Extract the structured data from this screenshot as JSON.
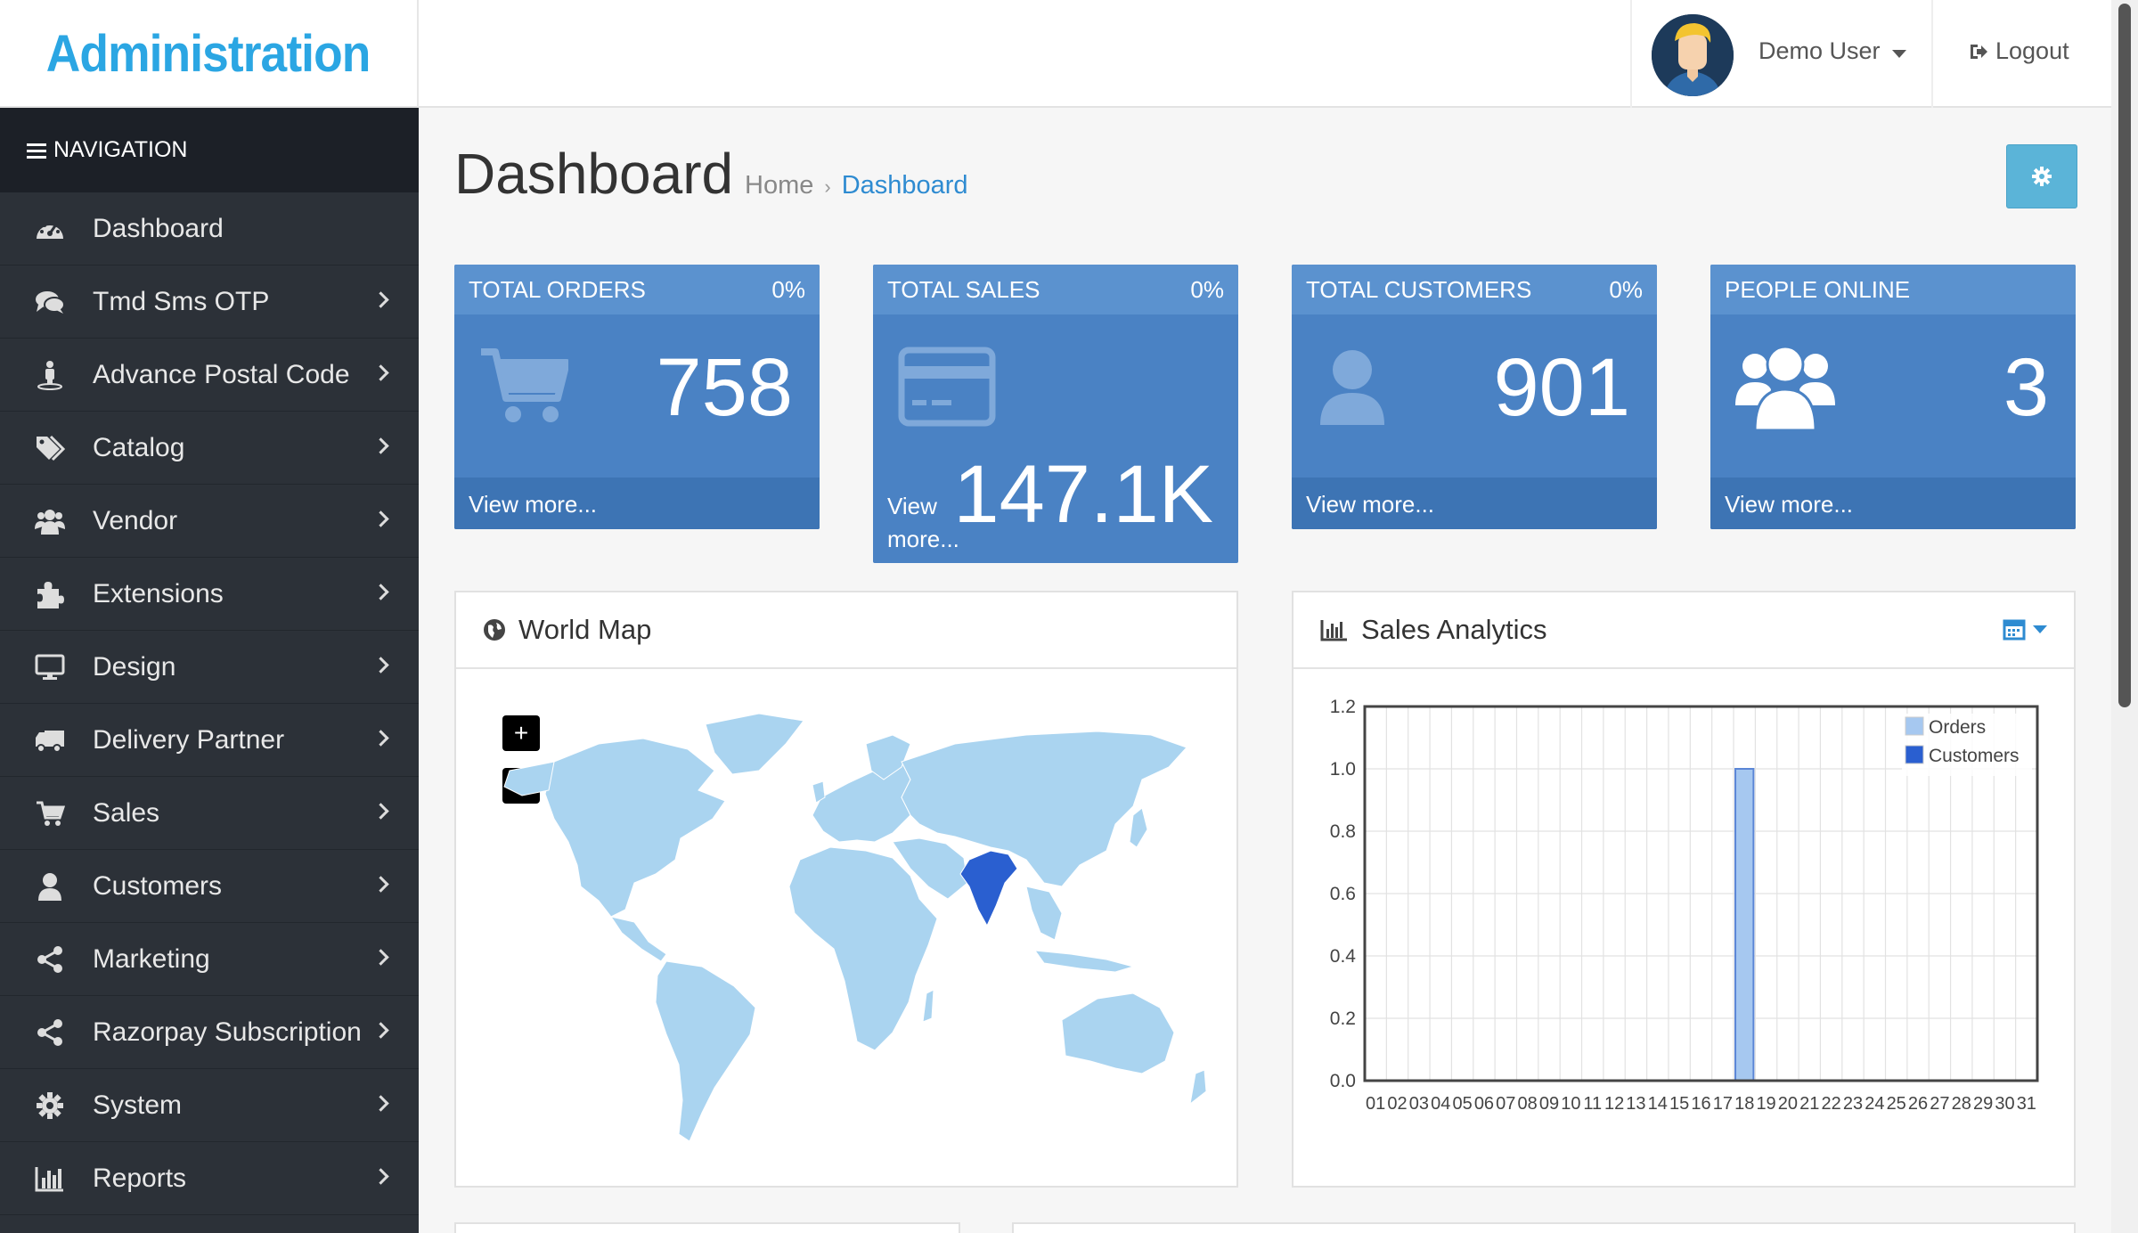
{
  "header": {
    "logo_text": "Administration",
    "user_name": "Demo User",
    "logout_label": "Logout"
  },
  "sidebar": {
    "nav_title": "NAVIGATION",
    "items": [
      {
        "label": "Dashboard",
        "icon": "dashboard-icon",
        "has_children": false
      },
      {
        "label": "Tmd Sms OTP",
        "icon": "comments-icon",
        "has_children": true
      },
      {
        "label": "Advance Postal Code",
        "icon": "street-view-icon",
        "has_children": true
      },
      {
        "label": "Catalog",
        "icon": "tags-icon",
        "has_children": true
      },
      {
        "label": "Vendor",
        "icon": "users-icon",
        "has_children": true
      },
      {
        "label": "Extensions",
        "icon": "puzzle-piece-icon",
        "has_children": true
      },
      {
        "label": "Design",
        "icon": "desktop-icon",
        "has_children": true
      },
      {
        "label": "Delivery Partner",
        "icon": "truck-icon",
        "has_children": true
      },
      {
        "label": "Sales",
        "icon": "shopping-cart-icon",
        "has_children": true
      },
      {
        "label": "Customers",
        "icon": "user-icon",
        "has_children": true
      },
      {
        "label": "Marketing",
        "icon": "share-alt-icon",
        "has_children": true
      },
      {
        "label": "Razorpay Subscription",
        "icon": "share-alt-icon",
        "has_children": true
      },
      {
        "label": "System",
        "icon": "cog-icon",
        "has_children": true
      },
      {
        "label": "Reports",
        "icon": "bar-chart-icon",
        "has_children": true
      }
    ]
  },
  "page": {
    "title": "Dashboard",
    "breadcrumb": [
      "Home",
      "Dashboard"
    ]
  },
  "tiles": [
    {
      "title": "TOTAL ORDERS",
      "percent": "0%",
      "value": "758",
      "footer": "View more...",
      "icon": "shopping-cart-icon"
    },
    {
      "title": "TOTAL SALES",
      "percent": "0%",
      "value": "147.1K",
      "footer": "View more...",
      "icon": "credit-card-icon"
    },
    {
      "title": "TOTAL CUSTOMERS",
      "percent": "0%",
      "value": "901",
      "footer": "View more...",
      "icon": "user-icon"
    },
    {
      "title": "PEOPLE ONLINE",
      "percent": "",
      "value": "3",
      "footer": "View more...",
      "icon": "users-icon"
    }
  ],
  "world_map": {
    "title": "World Map",
    "zoom_in": "+",
    "zoom_out": "−",
    "base_color": "#aad4f0",
    "highlight_color": "#2a5fd0",
    "highlighted_country": "India"
  },
  "sales_analytics": {
    "title": "Sales Analytics"
  },
  "chart_data": {
    "type": "bar",
    "title": "",
    "xlabel": "",
    "ylabel": "",
    "categories": [
      "01",
      "02",
      "03",
      "04",
      "05",
      "06",
      "07",
      "08",
      "09",
      "10",
      "11",
      "12",
      "13",
      "14",
      "15",
      "16",
      "17",
      "18",
      "19",
      "20",
      "21",
      "22",
      "23",
      "24",
      "25",
      "26",
      "27",
      "28",
      "29",
      "30",
      "31"
    ],
    "series": [
      {
        "name": "Orders",
        "color": "#a6c8f0",
        "values": [
          0,
          0,
          0,
          0,
          0,
          0,
          0,
          0,
          0,
          0,
          0,
          0,
          0,
          0,
          0,
          0,
          0,
          1,
          0,
          0,
          0,
          0,
          0,
          0,
          0,
          0,
          0,
          0,
          0,
          0,
          0
        ]
      },
      {
        "name": "Customers",
        "color": "#2a5fd0",
        "values": [
          0,
          0,
          0,
          0,
          0,
          0,
          0,
          0,
          0,
          0,
          0,
          0,
          0,
          0,
          0,
          0,
          0,
          0,
          0,
          0,
          0,
          0,
          0,
          0,
          0,
          0,
          0,
          0,
          0,
          0,
          0
        ]
      }
    ],
    "ylim": [
      0,
      1.2
    ],
    "yticks": [
      "0.0",
      "0.2",
      "0.4",
      "0.6",
      "0.8",
      "1.0",
      "1.2"
    ],
    "grid": true,
    "legend": "top-right"
  },
  "colors": {
    "tile_bg": "#4a82c4",
    "sidebar_bg": "#2c3138",
    "accent": "#2e8bd1"
  }
}
